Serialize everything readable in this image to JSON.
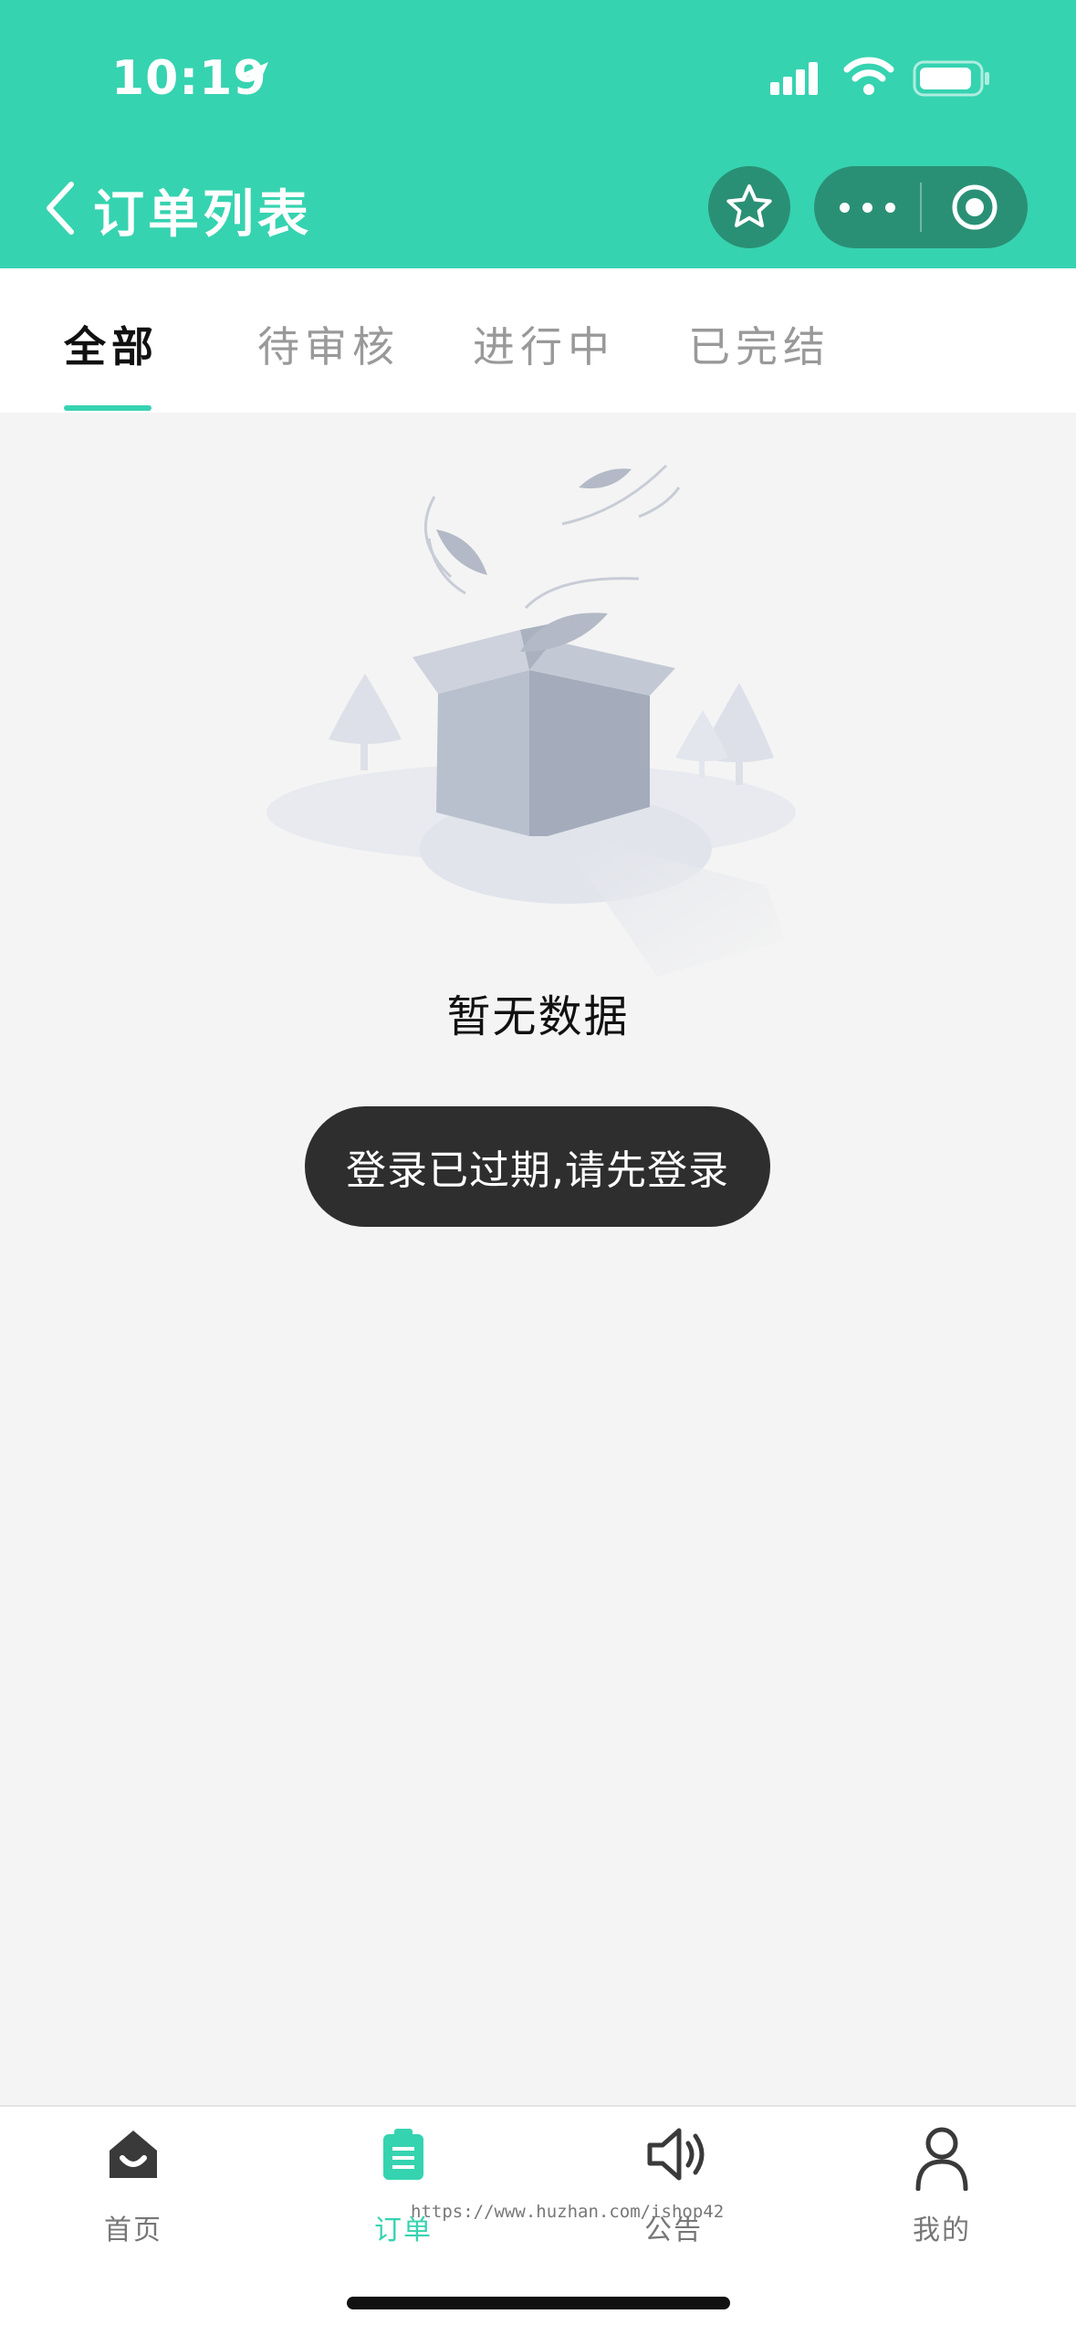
{
  "status_bar": {
    "time": "10:19"
  },
  "nav": {
    "title": "订单列表"
  },
  "tabs": [
    {
      "label": "全部",
      "active": true
    },
    {
      "label": "待审核",
      "active": false
    },
    {
      "label": "进行中",
      "active": false
    },
    {
      "label": "已完结",
      "active": false
    }
  ],
  "empty_state": {
    "text": "暂无数据"
  },
  "toast": {
    "text": "登录已过期,请先登录"
  },
  "tabbar": [
    {
      "label": "首页",
      "icon": "home-icon",
      "active": false
    },
    {
      "label": "订单",
      "icon": "order-icon",
      "active": true
    },
    {
      "label": "公告",
      "icon": "speaker-icon",
      "active": false
    },
    {
      "label": "我的",
      "icon": "user-icon",
      "active": false
    }
  ],
  "watermark": "https://www.huzhan.com/ishop42",
  "colors": {
    "accent": "#36d3b0",
    "capsule": "#2a9075",
    "toast": "#2e2e2e"
  }
}
